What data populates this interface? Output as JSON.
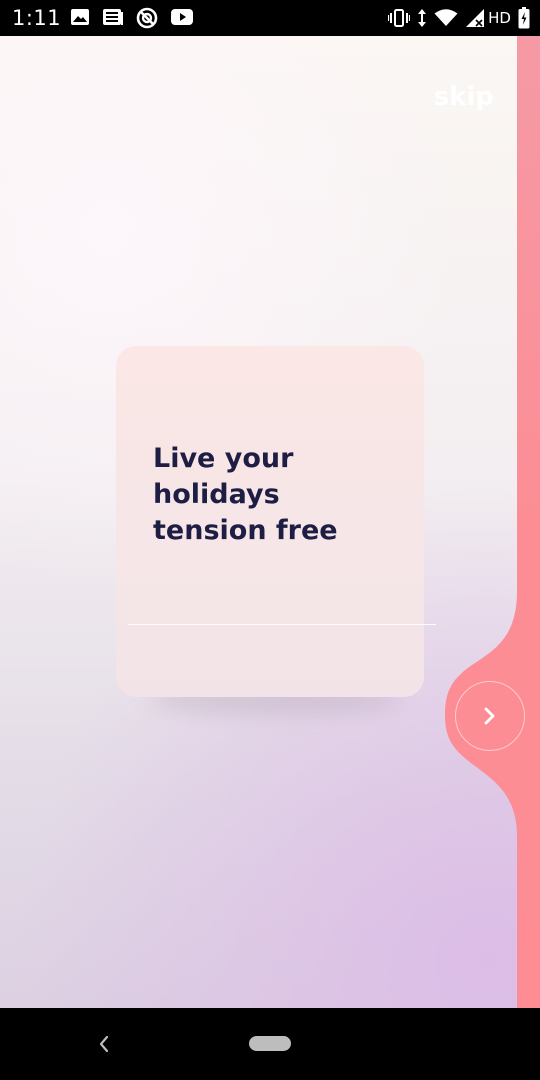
{
  "status_bar": {
    "time": "1:11",
    "network_label": "HD",
    "icons_left": [
      "image-icon",
      "news-icon",
      "blocked-icon",
      "youtube-icon"
    ],
    "icons_right": [
      "vibrate-icon",
      "data-arrows-icon",
      "wifi-icon",
      "signal-icon",
      "battery-icon"
    ]
  },
  "onboarding": {
    "skip_label": "skip",
    "card_title": "Live your holidays tension free",
    "next_icon": "chevron-right-icon"
  },
  "colors": {
    "accent": "#fc8d95",
    "title_text": "#1e1e45",
    "card_bg": "#f8e6e6"
  },
  "nav_bar": {
    "icons": [
      "back-icon",
      "home-pill"
    ]
  }
}
